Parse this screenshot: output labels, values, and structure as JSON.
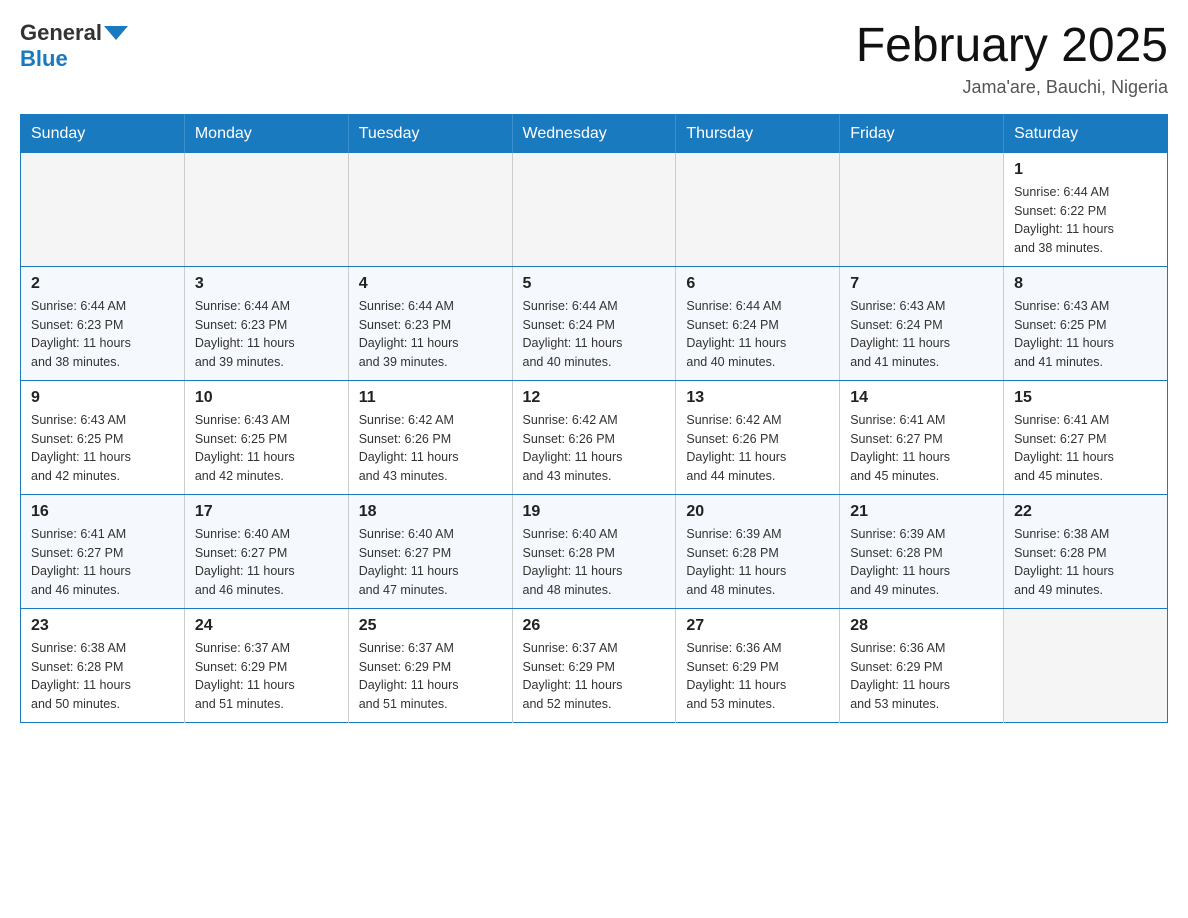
{
  "header": {
    "logo_general": "General",
    "logo_blue": "Blue",
    "month_title": "February 2025",
    "location": "Jama'are, Bauchi, Nigeria"
  },
  "days_of_week": [
    "Sunday",
    "Monday",
    "Tuesday",
    "Wednesday",
    "Thursday",
    "Friday",
    "Saturday"
  ],
  "weeks": [
    [
      {
        "day": "",
        "info": ""
      },
      {
        "day": "",
        "info": ""
      },
      {
        "day": "",
        "info": ""
      },
      {
        "day": "",
        "info": ""
      },
      {
        "day": "",
        "info": ""
      },
      {
        "day": "",
        "info": ""
      },
      {
        "day": "1",
        "info": "Sunrise: 6:44 AM\nSunset: 6:22 PM\nDaylight: 11 hours\nand 38 minutes."
      }
    ],
    [
      {
        "day": "2",
        "info": "Sunrise: 6:44 AM\nSunset: 6:23 PM\nDaylight: 11 hours\nand 38 minutes."
      },
      {
        "day": "3",
        "info": "Sunrise: 6:44 AM\nSunset: 6:23 PM\nDaylight: 11 hours\nand 39 minutes."
      },
      {
        "day": "4",
        "info": "Sunrise: 6:44 AM\nSunset: 6:23 PM\nDaylight: 11 hours\nand 39 minutes."
      },
      {
        "day": "5",
        "info": "Sunrise: 6:44 AM\nSunset: 6:24 PM\nDaylight: 11 hours\nand 40 minutes."
      },
      {
        "day": "6",
        "info": "Sunrise: 6:44 AM\nSunset: 6:24 PM\nDaylight: 11 hours\nand 40 minutes."
      },
      {
        "day": "7",
        "info": "Sunrise: 6:43 AM\nSunset: 6:24 PM\nDaylight: 11 hours\nand 41 minutes."
      },
      {
        "day": "8",
        "info": "Sunrise: 6:43 AM\nSunset: 6:25 PM\nDaylight: 11 hours\nand 41 minutes."
      }
    ],
    [
      {
        "day": "9",
        "info": "Sunrise: 6:43 AM\nSunset: 6:25 PM\nDaylight: 11 hours\nand 42 minutes."
      },
      {
        "day": "10",
        "info": "Sunrise: 6:43 AM\nSunset: 6:25 PM\nDaylight: 11 hours\nand 42 minutes."
      },
      {
        "day": "11",
        "info": "Sunrise: 6:42 AM\nSunset: 6:26 PM\nDaylight: 11 hours\nand 43 minutes."
      },
      {
        "day": "12",
        "info": "Sunrise: 6:42 AM\nSunset: 6:26 PM\nDaylight: 11 hours\nand 43 minutes."
      },
      {
        "day": "13",
        "info": "Sunrise: 6:42 AM\nSunset: 6:26 PM\nDaylight: 11 hours\nand 44 minutes."
      },
      {
        "day": "14",
        "info": "Sunrise: 6:41 AM\nSunset: 6:27 PM\nDaylight: 11 hours\nand 45 minutes."
      },
      {
        "day": "15",
        "info": "Sunrise: 6:41 AM\nSunset: 6:27 PM\nDaylight: 11 hours\nand 45 minutes."
      }
    ],
    [
      {
        "day": "16",
        "info": "Sunrise: 6:41 AM\nSunset: 6:27 PM\nDaylight: 11 hours\nand 46 minutes."
      },
      {
        "day": "17",
        "info": "Sunrise: 6:40 AM\nSunset: 6:27 PM\nDaylight: 11 hours\nand 46 minutes."
      },
      {
        "day": "18",
        "info": "Sunrise: 6:40 AM\nSunset: 6:27 PM\nDaylight: 11 hours\nand 47 minutes."
      },
      {
        "day": "19",
        "info": "Sunrise: 6:40 AM\nSunset: 6:28 PM\nDaylight: 11 hours\nand 48 minutes."
      },
      {
        "day": "20",
        "info": "Sunrise: 6:39 AM\nSunset: 6:28 PM\nDaylight: 11 hours\nand 48 minutes."
      },
      {
        "day": "21",
        "info": "Sunrise: 6:39 AM\nSunset: 6:28 PM\nDaylight: 11 hours\nand 49 minutes."
      },
      {
        "day": "22",
        "info": "Sunrise: 6:38 AM\nSunset: 6:28 PM\nDaylight: 11 hours\nand 49 minutes."
      }
    ],
    [
      {
        "day": "23",
        "info": "Sunrise: 6:38 AM\nSunset: 6:28 PM\nDaylight: 11 hours\nand 50 minutes."
      },
      {
        "day": "24",
        "info": "Sunrise: 6:37 AM\nSunset: 6:29 PM\nDaylight: 11 hours\nand 51 minutes."
      },
      {
        "day": "25",
        "info": "Sunrise: 6:37 AM\nSunset: 6:29 PM\nDaylight: 11 hours\nand 51 minutes."
      },
      {
        "day": "26",
        "info": "Sunrise: 6:37 AM\nSunset: 6:29 PM\nDaylight: 11 hours\nand 52 minutes."
      },
      {
        "day": "27",
        "info": "Sunrise: 6:36 AM\nSunset: 6:29 PM\nDaylight: 11 hours\nand 53 minutes."
      },
      {
        "day": "28",
        "info": "Sunrise: 6:36 AM\nSunset: 6:29 PM\nDaylight: 11 hours\nand 53 minutes."
      },
      {
        "day": "",
        "info": ""
      }
    ]
  ]
}
